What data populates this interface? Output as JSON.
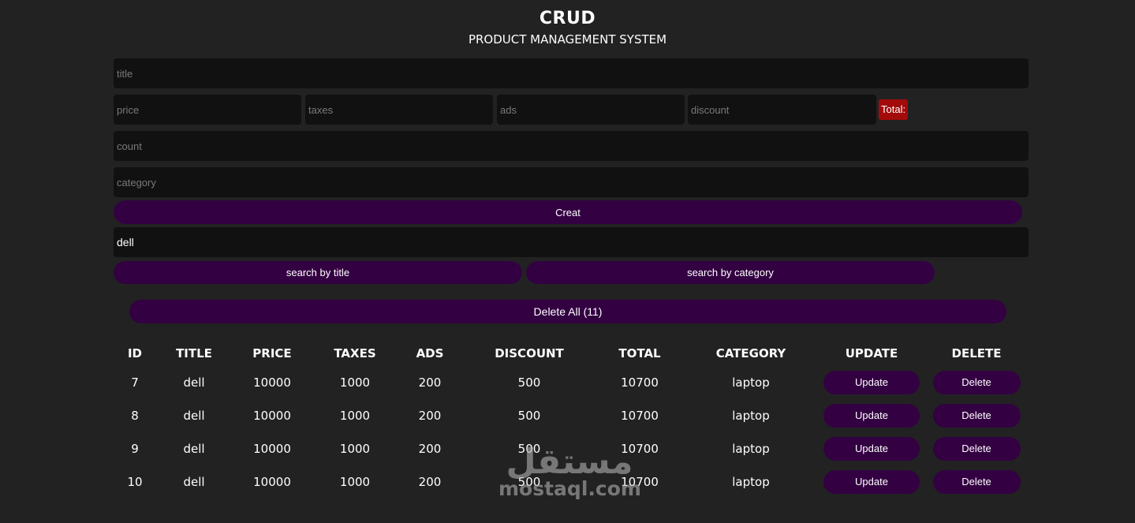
{
  "header": {
    "title": "CRUD",
    "subtitle": "PRODUCT MANAGEMENT SYSTEM"
  },
  "form": {
    "title_placeholder": "title",
    "price_placeholder": "price",
    "taxes_placeholder": "taxes",
    "ads_placeholder": "ads",
    "discount_placeholder": "discount",
    "total_label": "Total:",
    "total_color": "#a30b0b",
    "count_placeholder": "count",
    "category_placeholder": "category",
    "create_label": "Creat"
  },
  "search": {
    "value": "dell",
    "by_title_label": "search by title",
    "by_category_label": "search by category"
  },
  "delete_all_label": "Delete All (11)",
  "table": {
    "headers": [
      "ID",
      "TITLE",
      "PRICE",
      "TAXES",
      "ADS",
      "DISCOUNT",
      "TOTAL",
      "CATEGORY",
      "UPDATE",
      "DELETE"
    ],
    "rows": [
      {
        "id": "7",
        "title": "dell",
        "price": "10000",
        "taxes": "1000",
        "ads": "200",
        "discount": "500",
        "total": "10700",
        "category": "laptop",
        "update": "Update",
        "delete": "Delete"
      },
      {
        "id": "8",
        "title": "dell",
        "price": "10000",
        "taxes": "1000",
        "ads": "200",
        "discount": "500",
        "total": "10700",
        "category": "laptop",
        "update": "Update",
        "delete": "Delete"
      },
      {
        "id": "9",
        "title": "dell",
        "price": "10000",
        "taxes": "1000",
        "ads": "200",
        "discount": "500",
        "total": "10700",
        "category": "laptop",
        "update": "Update",
        "delete": "Delete"
      },
      {
        "id": "10",
        "title": "dell",
        "price": "10000",
        "taxes": "1000",
        "ads": "200",
        "discount": "500",
        "total": "10700",
        "category": "laptop",
        "update": "Update",
        "delete": "Delete"
      }
    ]
  },
  "watermark": {
    "arabic": "مستقل",
    "latin": "mostaql.com"
  },
  "colors": {
    "background": "#222222",
    "input_bg": "#111111",
    "button_bg": "#330042"
  }
}
